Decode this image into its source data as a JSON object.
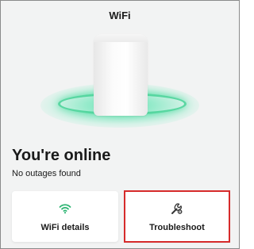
{
  "header": {
    "title": "WiFi"
  },
  "status": {
    "headline": "You're online",
    "detail": "No outages found"
  },
  "actions": [
    {
      "label": "WiFi details",
      "icon": "wifi-icon"
    },
    {
      "label": "Troubleshoot",
      "icon": "wrench-gear-icon"
    }
  ],
  "colors": {
    "accent_green": "#2fb574",
    "highlight_red": "#d62b2b",
    "background": "#f2f3f3"
  }
}
